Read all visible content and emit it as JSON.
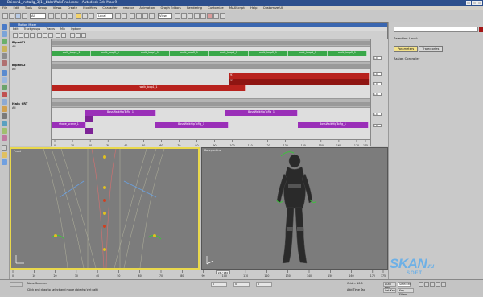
{
  "window": {
    "title": "Bsisen1_Installg_3(1)_bbbrWalkFinal.max - Autodesk 3ds Max 9"
  },
  "menu": [
    "File",
    "Edit",
    "Tools",
    "Group",
    "Views",
    "Create",
    "Modifiers",
    "Character",
    "reactor",
    "Animation",
    "Graph Editors",
    "Rendering",
    "Customize",
    "MAXScript",
    "Help",
    "Customize UI"
  ],
  "toolbar": {
    "filter_value": "All",
    "coord_value": "Local",
    "named_sel_value": "View"
  },
  "motion_mixer": {
    "title": "Motion Mixer",
    "menu": [
      "Edit",
      "Trackgroups",
      "Tracks",
      "Mix",
      "Options"
    ],
    "tracks": [
      {
        "name": "Biped01",
        "label": "All"
      },
      {
        "name": "Biped02",
        "label": "All"
      },
      {
        "name": "Main_CRT",
        "label": "All"
      }
    ],
    "walk_clips": [
      "walk_loop1_1",
      "walk_loop2_1",
      "walk_loop1_1",
      "walk_loop2_1",
      "walk_loop1_1",
      "walk_loop2_1",
      "walk_loop1_1",
      "walk_loop2_1"
    ],
    "walk_marks": [
      "0",
      "20",
      "50",
      "80",
      "110",
      "170"
    ],
    "red_clip": "walk_loop1_1",
    "red_marks": [
      "97",
      "97",
      "175"
    ],
    "purple_clips": [
      "BossWalkHipToFig_1",
      "BossWalkHipToFig_1",
      "BossWalkHipToFig_1",
      "BossWalkHipToFig_1",
      "BossWalkHipToFig_1"
    ],
    "purple_extra": "shake_scene_1",
    "ruler_ticks": [
      "0",
      "10",
      "20",
      "30",
      "40",
      "50",
      "60",
      "70",
      "80",
      "90",
      "100",
      "110",
      "120",
      "130",
      "140",
      "150",
      "160",
      "170",
      "175"
    ],
    "spinner_value": "1.0"
  },
  "viewports": {
    "left_label": "Front",
    "right_label": "Perspective"
  },
  "right_panel": {
    "selection_label": "Selection Level:",
    "tab_parameters": "Parameters",
    "tab_trajectories": "Trajectories",
    "assign_controller": "Assign Controller"
  },
  "timeline": {
    "ticks": [
      "0",
      "10",
      "20",
      "30",
      "40",
      "50",
      "60",
      "70",
      "80",
      "90",
      "100",
      "110",
      "120",
      "130",
      "140",
      "150",
      "160",
      "170",
      "175"
    ],
    "frame_display": "24 / 180"
  },
  "status": {
    "selected": "None Selected",
    "prompt": "Click and drag to select and move objects (ctrl=alt)",
    "x_value": "0",
    "y_value": "0",
    "z_value": "0",
    "grid": "Grid = 10.0",
    "auto_key": "Auto Key",
    "set_key": "Set Key",
    "selected_mode": "Selected",
    "key_filters": "Key Filters...",
    "add_time_tag": "Add Time Tag"
  },
  "watermark": {
    "main": "SKAN",
    "suffix": ".ru",
    "sub": "SOFT"
  }
}
